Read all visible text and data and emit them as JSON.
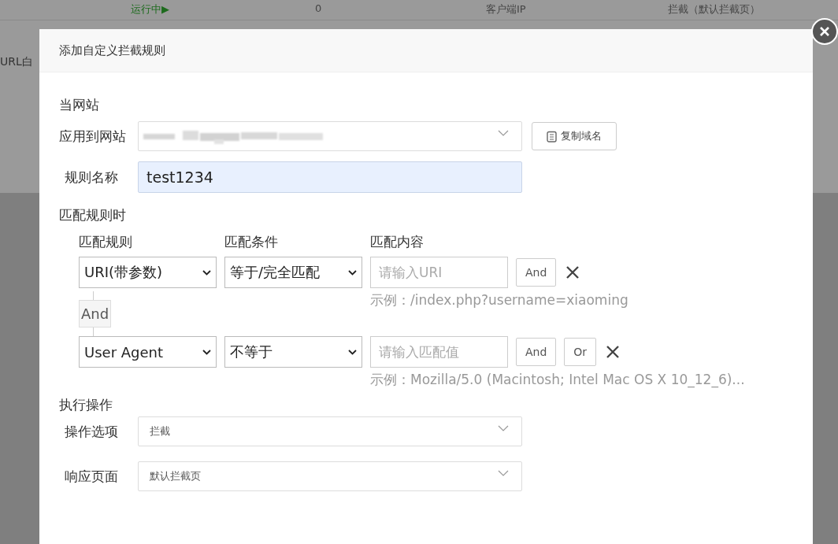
{
  "background": {
    "row": [
      "运行中▶",
      "0",
      "客户端IP",
      "拦截（默认拦截页）"
    ],
    "side_label": "URL白"
  },
  "dialog": {
    "title": "添加自定义拦截规则",
    "section_site": "当网站",
    "site": {
      "label": "应用到网站",
      "copy_button": "复制域名"
    },
    "rule_name": {
      "label": "规则名称",
      "value": "test1234"
    },
    "section_match": "匹配规则时",
    "columns": [
      "匹配规则",
      "匹配条件",
      "匹配内容"
    ],
    "conditions": [
      {
        "field": "URI(带参数)",
        "operator": "等于/完全匹配",
        "placeholder": "请输入URI",
        "example": "示例：/index.php?username=xiaoming",
        "buttons": [
          "And"
        ]
      },
      {
        "join": "And",
        "field": "User Agent",
        "operator": "不等于",
        "placeholder": "请输入匹配值",
        "example": "示例：Mozilla/5.0 (Macintosh; Intel Mac OS X 10_12_6)...",
        "buttons": [
          "And",
          "Or"
        ]
      }
    ],
    "section_action": "执行操作",
    "actions": [
      {
        "label": "操作选项",
        "value": "拦截"
      },
      {
        "label": "响应页面",
        "value": "默认拦截页"
      }
    ]
  }
}
